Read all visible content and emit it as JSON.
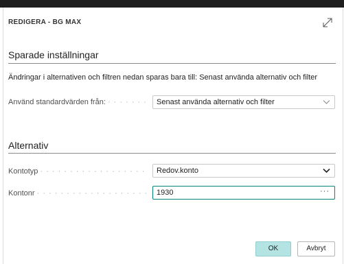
{
  "dialog": {
    "title": "REDIGERA - BG MAX",
    "expand_icon": "expand-diagonal-arrow-icon"
  },
  "saved_settings": {
    "heading": "Sparade inställningar",
    "info": "Ändringar i alternativen och filtren nedan sparas bara till: Senast använda alternativ och filter",
    "use_defaults_label": "Använd standardvärden från:",
    "use_defaults_value": "Senast använda alternativ och filter"
  },
  "options": {
    "heading": "Alternativ",
    "account_type_label": "Kontotyp",
    "account_type_value": "Redov.konto",
    "account_no_label": "Kontonr",
    "account_no_value": "1930",
    "lookup_glyph": "···"
  },
  "buttons": {
    "ok": "OK",
    "cancel": "Avbryt"
  },
  "colors": {
    "accent": "#00857c",
    "ok_button": "#b4e3e3"
  }
}
